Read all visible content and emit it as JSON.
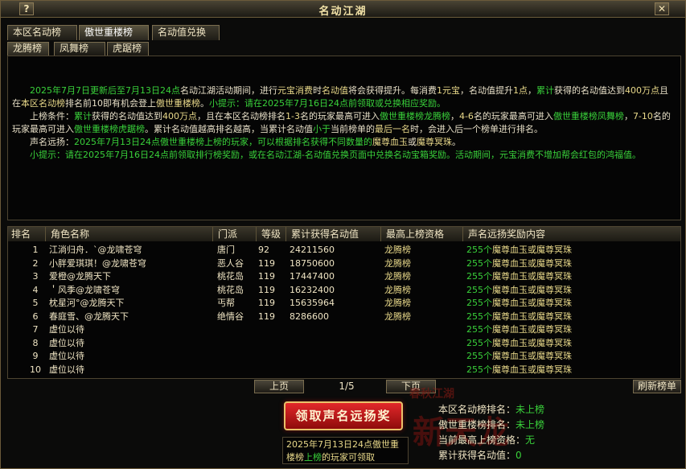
{
  "window": {
    "title": "名动江湖",
    "help_label": "?",
    "close_label": "✕"
  },
  "tabs_main": [
    "本区名动榜",
    "傲世重楼榜",
    "名动值兑换"
  ],
  "tabs_sub": [
    "龙腾榜",
    "凤舞榜",
    "虎踞榜"
  ],
  "desc": {
    "p1_a": "2025年7月7日更新后至7月13日24点",
    "p1_b": "名动江湖活动期间，进行",
    "p1_c": "元宝消费",
    "p1_d": "时",
    "p1_e": "名动值",
    "p1_f": "将会获得提升。每消费",
    "p1_g": "1元宝",
    "p1_h": "，名动值提升",
    "p1_i": "1点",
    "p1_j": "，",
    "p1_k": "累计",
    "p1_l": "获得的名动值达到",
    "p1_m": "400万点",
    "p1_n": "且在",
    "p1_o": "本区名动榜",
    "p1_p": "排名前10",
    "p1_q": "即有机会登上",
    "p1_r": "傲世重楼榜",
    "p1_s": "。",
    "p1_t": "小提示：请在2025年7月16日24点前领取或兑换相应奖励。",
    "p2_a": "上榜条件：",
    "p2_b": "累计",
    "p2_c": "获得的名动值达到",
    "p2_d": "400万点",
    "p2_e": "，且在本区名动榜排名",
    "p2_f": "1-3",
    "p2_g": "名的玩家最高可进入",
    "p2_h": "傲世重楼榜龙腾榜",
    "p2_i": "，",
    "p2_j": "4-6",
    "p2_k": "名的玩家最高可进入",
    "p2_l": "傲世重楼榜凤舞榜",
    "p2_m": "，",
    "p2_n": "7-10",
    "p2_o": "名的玩家最高可进入",
    "p2_p": "傲世重楼榜虎踞榜",
    "p2_q": "。累计名动值越高排名越高，当累计名动值",
    "p2_r": "小于",
    "p2_s": "当前榜单的",
    "p2_t": "最后一名",
    "p2_u": "时，会进入后一个榜单进行排名。",
    "p3_a": "声名远扬：",
    "p3_b": "2025年7月13日24点傲世重楼榜上榜的玩家，可以根据排名获得不同数量的",
    "p3_c": "魔尊血玉",
    "p3_d": "或",
    "p3_e": "魔尊冥珠",
    "p3_f": "。",
    "p4": "小提示：请在2025年7月16日24点前领取排行榜奖励，或在名动江湖-名动值兑换页面中兑换名动宝箱奖励。活动期间，元宝消费不增加帮会红包的鸿福值。"
  },
  "table": {
    "headers": [
      "排名",
      "角色名称",
      "门派",
      "等级",
      "累计获得名动值",
      "最高上榜资格",
      "声名远扬奖励内容"
    ],
    "rows": [
      {
        "rank": "1",
        "name": "江淌归舟．`@龙啸苍穹",
        "school": "唐门",
        "level": "92",
        "score": "24211560",
        "qual": "龙腾榜",
        "reward_num": "255个",
        "reward_txt": "魔尊血玉或魔尊冥珠"
      },
      {
        "rank": "2",
        "name": "小胖爱琪琪！@龙啸苍穹",
        "school": "恶人谷",
        "level": "119",
        "score": "18750600",
        "qual": "龙腾榜",
        "reward_num": "255个",
        "reward_txt": "魔尊血玉或魔尊冥珠"
      },
      {
        "rank": "3",
        "name": "爱橙@龙腾天下",
        "school": "桃花岛",
        "level": "119",
        "score": "17447400",
        "qual": "龙腾榜",
        "reward_num": "255个",
        "reward_txt": "魔尊血玉或魔尊冥珠"
      },
      {
        "rank": "4",
        "name": "＇风季@龙啸苍穹",
        "school": "桃花岛",
        "level": "119",
        "score": "16232400",
        "qual": "龙腾榜",
        "reward_num": "255个",
        "reward_txt": "魔尊血玉或魔尊冥珠"
      },
      {
        "rank": "5",
        "name": "枕星河°@龙腾天下",
        "school": "丐帮",
        "level": "119",
        "score": "15635964",
        "qual": "龙腾榜",
        "reward_num": "255个",
        "reward_txt": "魔尊血玉或魔尊冥珠"
      },
      {
        "rank": "6",
        "name": "春庭雪、@龙腾天下",
        "school": "绝情谷",
        "level": "119",
        "score": "8286600",
        "qual": "龙腾榜",
        "reward_num": "255个",
        "reward_txt": "魔尊血玉或魔尊冥珠"
      },
      {
        "rank": "7",
        "name": "虚位以待",
        "school": "",
        "level": "",
        "score": "",
        "qual": "",
        "reward_num": "255个",
        "reward_txt": "魔尊血玉或魔尊冥珠"
      },
      {
        "rank": "8",
        "name": "虚位以待",
        "school": "",
        "level": "",
        "score": "",
        "qual": "",
        "reward_num": "255个",
        "reward_txt": "魔尊血玉或魔尊冥珠"
      },
      {
        "rank": "9",
        "name": "虚位以待",
        "school": "",
        "level": "",
        "score": "",
        "qual": "",
        "reward_num": "255个",
        "reward_txt": "魔尊血玉或魔尊冥珠"
      },
      {
        "rank": "10",
        "name": "虚位以待",
        "school": "",
        "level": "",
        "score": "",
        "qual": "",
        "reward_num": "255个",
        "reward_txt": "魔尊血玉或魔尊冥珠"
      }
    ]
  },
  "pager": {
    "prev": "上页",
    "info": "1/5",
    "next": "下页",
    "refresh": "刷新榜单"
  },
  "claim_button": "领取声名远扬奖",
  "note": {
    "a": "2025年7月13日24点傲世重",
    "b": "楼榜",
    "c": "上榜",
    "d": "的玩家可领取"
  },
  "deco": {
    "d1": "春秋江湖",
    "d2": "新天龙"
  },
  "stats": [
    {
      "label": "本区名动榜排名：",
      "value": "未上榜"
    },
    {
      "label": "傲世重楼榜排名：",
      "value": "未上榜"
    },
    {
      "label": "当前最高上榜资格：",
      "value": "无"
    },
    {
      "label": "累计获得名动值：",
      "value": "0"
    }
  ]
}
